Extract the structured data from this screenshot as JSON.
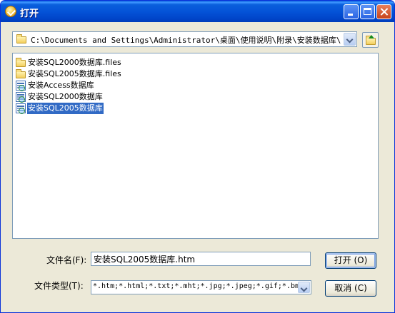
{
  "window": {
    "title": "打开"
  },
  "path": {
    "value": "C:\\Documents and Settings\\Administrator\\桌面\\使用说明\\附录\\安装数据库\\"
  },
  "files": [
    {
      "name": "安装SQL2000数据库.files",
      "icon": "folder-icon",
      "selected": false
    },
    {
      "name": "安装SQL2005数据库.files",
      "icon": "folder-icon",
      "selected": false
    },
    {
      "name": "安装Access数据库",
      "icon": "html-document-icon",
      "selected": false
    },
    {
      "name": "安装SQL2000数据库",
      "icon": "html-document-icon",
      "selected": false
    },
    {
      "name": "安装SQL2005数据库",
      "icon": "html-document-icon",
      "selected": true
    }
  ],
  "form": {
    "filename_label": "文件名(F):",
    "filename_value": "安装SQL2005数据库.htm",
    "filetype_label": "文件类型(T):",
    "filetype_value": "*.htm;*.html;*.txt;*.mht;*.jpg;*.jpeg;*.gif;*.bmp;",
    "open_button": "打开 (O)",
    "cancel_button": "取消 (C)"
  },
  "colors": {
    "titlebar": "#0453d8",
    "selection": "#316ac5",
    "dialog_bg": "#ece9d8"
  }
}
